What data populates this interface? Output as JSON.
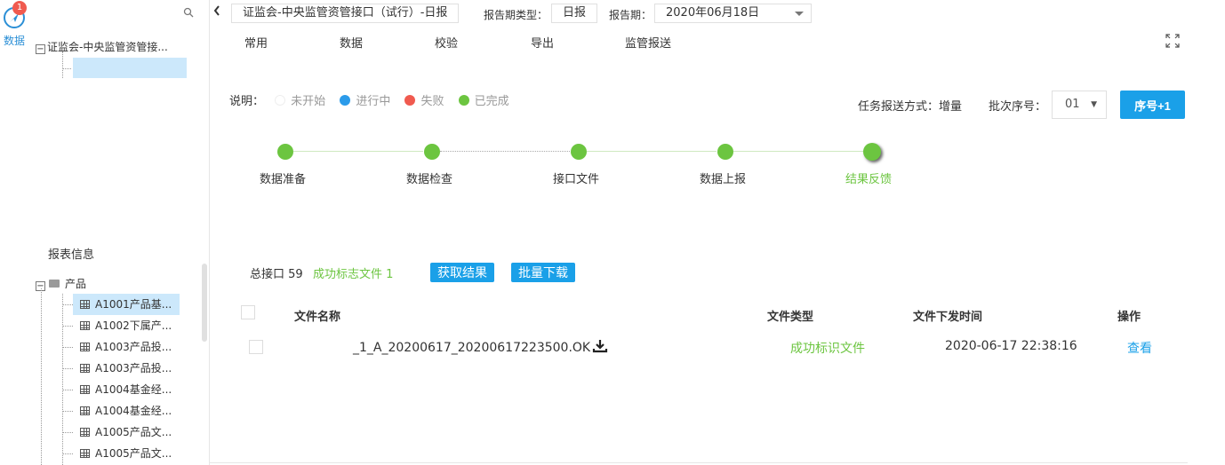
{
  "rail": {
    "badge": "1",
    "label": "数据"
  },
  "tree": {
    "root_label": "证监会-中央监管资管接...",
    "report_title": "报表信息",
    "products_label": "产品",
    "items": [
      "A1001产品基...",
      "A1002下属产...",
      "A1003产品投...",
      "A1003产品投...",
      "A1004基金经...",
      "A1004基金经...",
      "A1005产品文...",
      "A1005产品文..."
    ]
  },
  "header": {
    "title": "证监会-中央监管资管接口（试行）-日报",
    "period_type_label": "报告期类型：",
    "period_type_value": "日报",
    "period_label": "报告期：",
    "period_value": "2020年06月18日"
  },
  "menu": [
    "常用",
    "数据",
    "校验",
    "导出",
    "监管报送"
  ],
  "legend": {
    "label": "说明：",
    "items": [
      {
        "text": "未开始",
        "color": "#ffffff"
      },
      {
        "text": "进行中",
        "color": "#2b9bea"
      },
      {
        "text": "失败",
        "color": "#f05a4f"
      },
      {
        "text": "已完成",
        "color": "#6cc540"
      }
    ]
  },
  "task": {
    "mode_text": "任务报送方式：增量",
    "batch_label": "批次序号：",
    "batch_value": "01",
    "inc_button": "序号+1"
  },
  "steps": [
    "数据准备",
    "数据检查",
    "接口文件",
    "数据上报",
    "结果反馈"
  ],
  "summary": {
    "total": "总接口 59",
    "success": "成功标志文件 1",
    "fetch_button": "获取结果",
    "download_button": "批量下载"
  },
  "table": {
    "headers": [
      "文件名称",
      "文件类型",
      "文件下发时间",
      "操作"
    ],
    "rows": [
      {
        "name": "_1_A_20200617_20200617223500.OK",
        "type": "成功标识文件",
        "time": "2020-06-17 22:38:16",
        "action": "查看"
      }
    ]
  },
  "colors": {
    "accent": "#1aa0e8",
    "done": "#6cc540",
    "fail": "#f05a4f"
  }
}
